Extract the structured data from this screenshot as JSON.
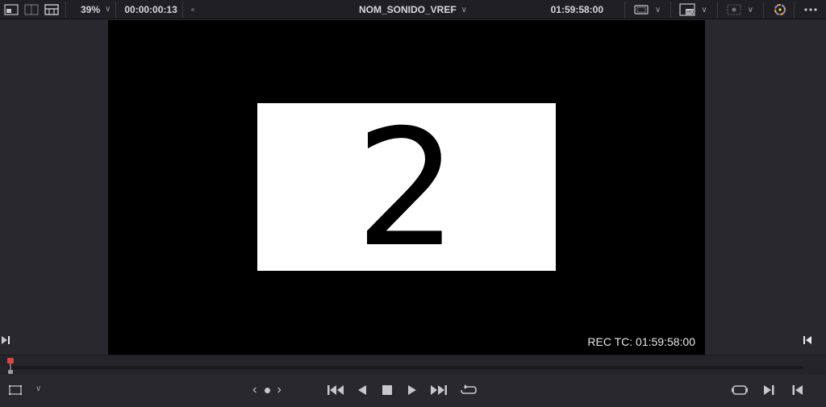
{
  "toolbar": {
    "zoom": "39%",
    "source_timecode": "00:00:00:13",
    "clip_name": "NOM_SONIDO_VREF",
    "record_timecode": "01:59:58:00",
    "icons": [
      "viewer-layout-single-icon",
      "viewer-layout-dual-icon",
      "viewer-layout-grid-icon",
      "zoom-chevron-icon",
      "clip-dropdown-chevron-icon",
      "safe-area-icon",
      "hq-playback-icon",
      "scopes-icon",
      "color-wheel-icon",
      "more-options-icon"
    ]
  },
  "viewer": {
    "card_number": "2",
    "rec_tc": "REC TC: 01:59:58:00"
  },
  "transport": {
    "nav_prev": "‹",
    "nav_next": "›",
    "icons": [
      "frame-guide-icon",
      "jump-to-start-icon",
      "play-reverse-icon",
      "stop-icon",
      "play-icon",
      "jump-to-end-icon",
      "loop-icon",
      "match-frame-icon",
      "next-edit-icon",
      "prev-edit-icon"
    ]
  },
  "colors": {
    "playhead": "#e0443a",
    "background": "#28282e",
    "frame": "#000000",
    "card": "#ffffff"
  }
}
